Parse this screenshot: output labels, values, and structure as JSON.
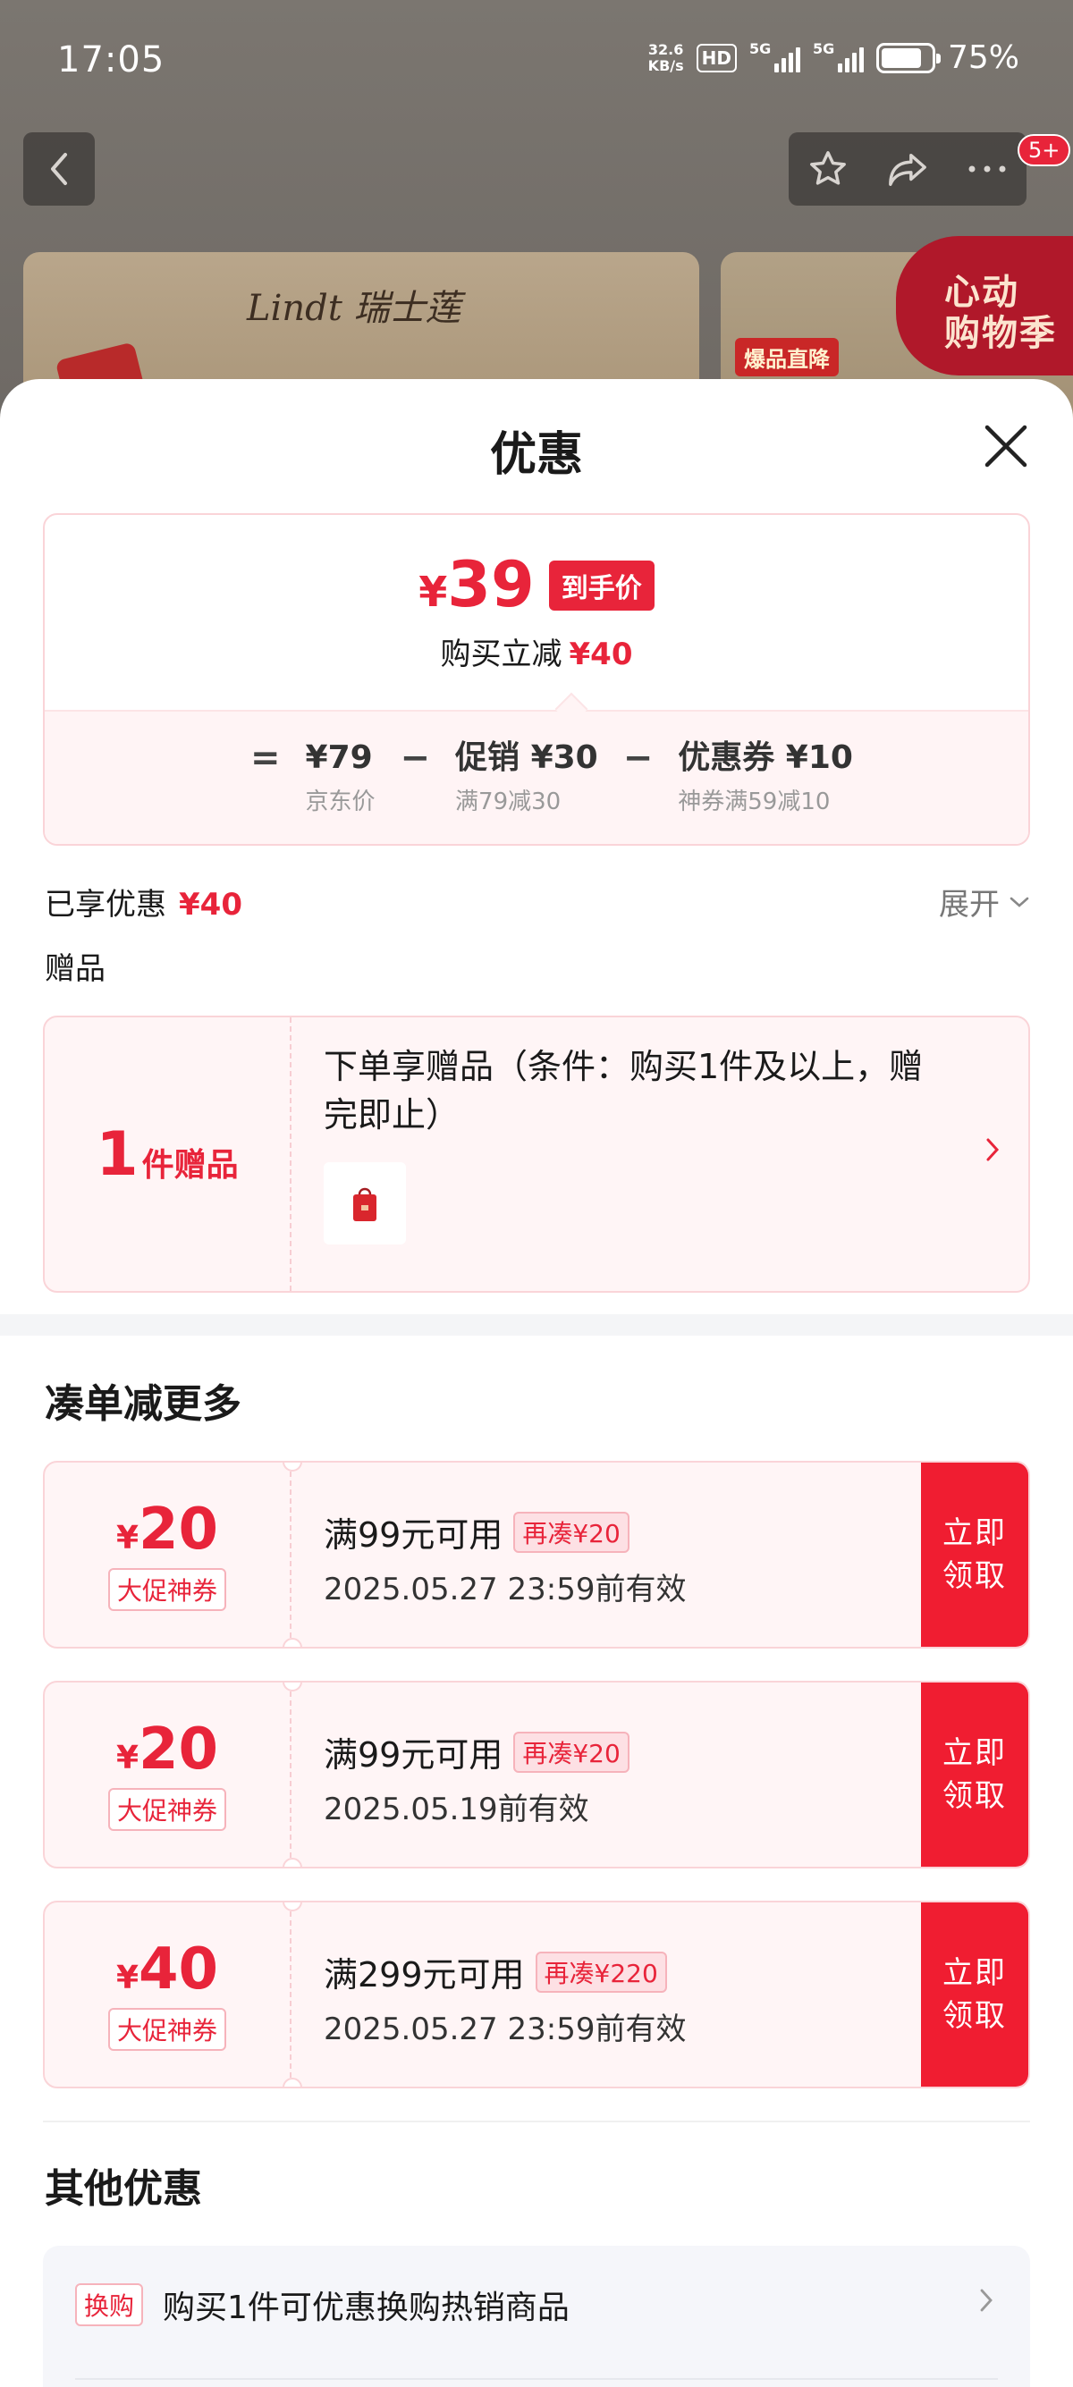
{
  "status_bar": {
    "time": "17:05",
    "net_speed_value": "32.6",
    "net_speed_unit": "KB/s",
    "hd_label": "HD",
    "signal1_label": "5G",
    "signal2_label": "5G",
    "battery": "75%"
  },
  "nav": {
    "badge": "5+"
  },
  "background": {
    "brand": "Lindt 瑞士莲",
    "banner_tag": "爆品直降",
    "promo_badge_line1": "心动",
    "promo_badge_line2": "购物季"
  },
  "sheet": {
    "title": "优惠",
    "price_summary": {
      "currency": "¥",
      "final_price": "39",
      "final_tag": "到手价",
      "saved_label": "购买立减",
      "saved_amount": "¥40",
      "equals": "=",
      "minus": "−",
      "base": {
        "value": "¥79",
        "sub": "京东价"
      },
      "promo": {
        "value": "促销 ¥30",
        "sub": "满79减30"
      },
      "coupon": {
        "value": "优惠券 ¥10",
        "sub": "神券满59减10"
      }
    },
    "enjoyed": {
      "label": "已享优惠",
      "amount": "¥40"
    },
    "expand_label": "展开",
    "gift": {
      "section_label": "赠品",
      "count": "1",
      "count_unit": "件赠品",
      "description": "下单享赠品（条件：购买1件及以上，赠完即止）"
    },
    "more_section_title": "凑单减更多",
    "coupons": [
      {
        "currency": "¥",
        "amount": "20",
        "kind": "大促神券",
        "condition": "满99元可用",
        "pill": "再凑¥20",
        "expiry": "2025.05.27 23:59前有效",
        "button_line1": "立即",
        "button_line2": "领取"
      },
      {
        "currency": "¥",
        "amount": "20",
        "kind": "大促神券",
        "condition": "满99元可用",
        "pill": "再凑¥20",
        "expiry": "2025.05.19前有效",
        "button_line1": "立即",
        "button_line2": "领取"
      },
      {
        "currency": "¥",
        "amount": "40",
        "kind": "大促神券",
        "condition": "满299元可用",
        "pill": "再凑¥220",
        "expiry": "2025.05.27 23:59前有效",
        "button_line1": "立即",
        "button_line2": "领取"
      }
    ],
    "other_section_title": "其他优惠",
    "other_items": [
      {
        "tag": "换购",
        "text": "购买1件可优惠换购热销商品"
      }
    ]
  },
  "colors": {
    "accent_red": "#e8243a",
    "button_red": "#f01d31",
    "card_pink_bg": "#fff5f6",
    "card_pink_border": "#fad4d8"
  }
}
